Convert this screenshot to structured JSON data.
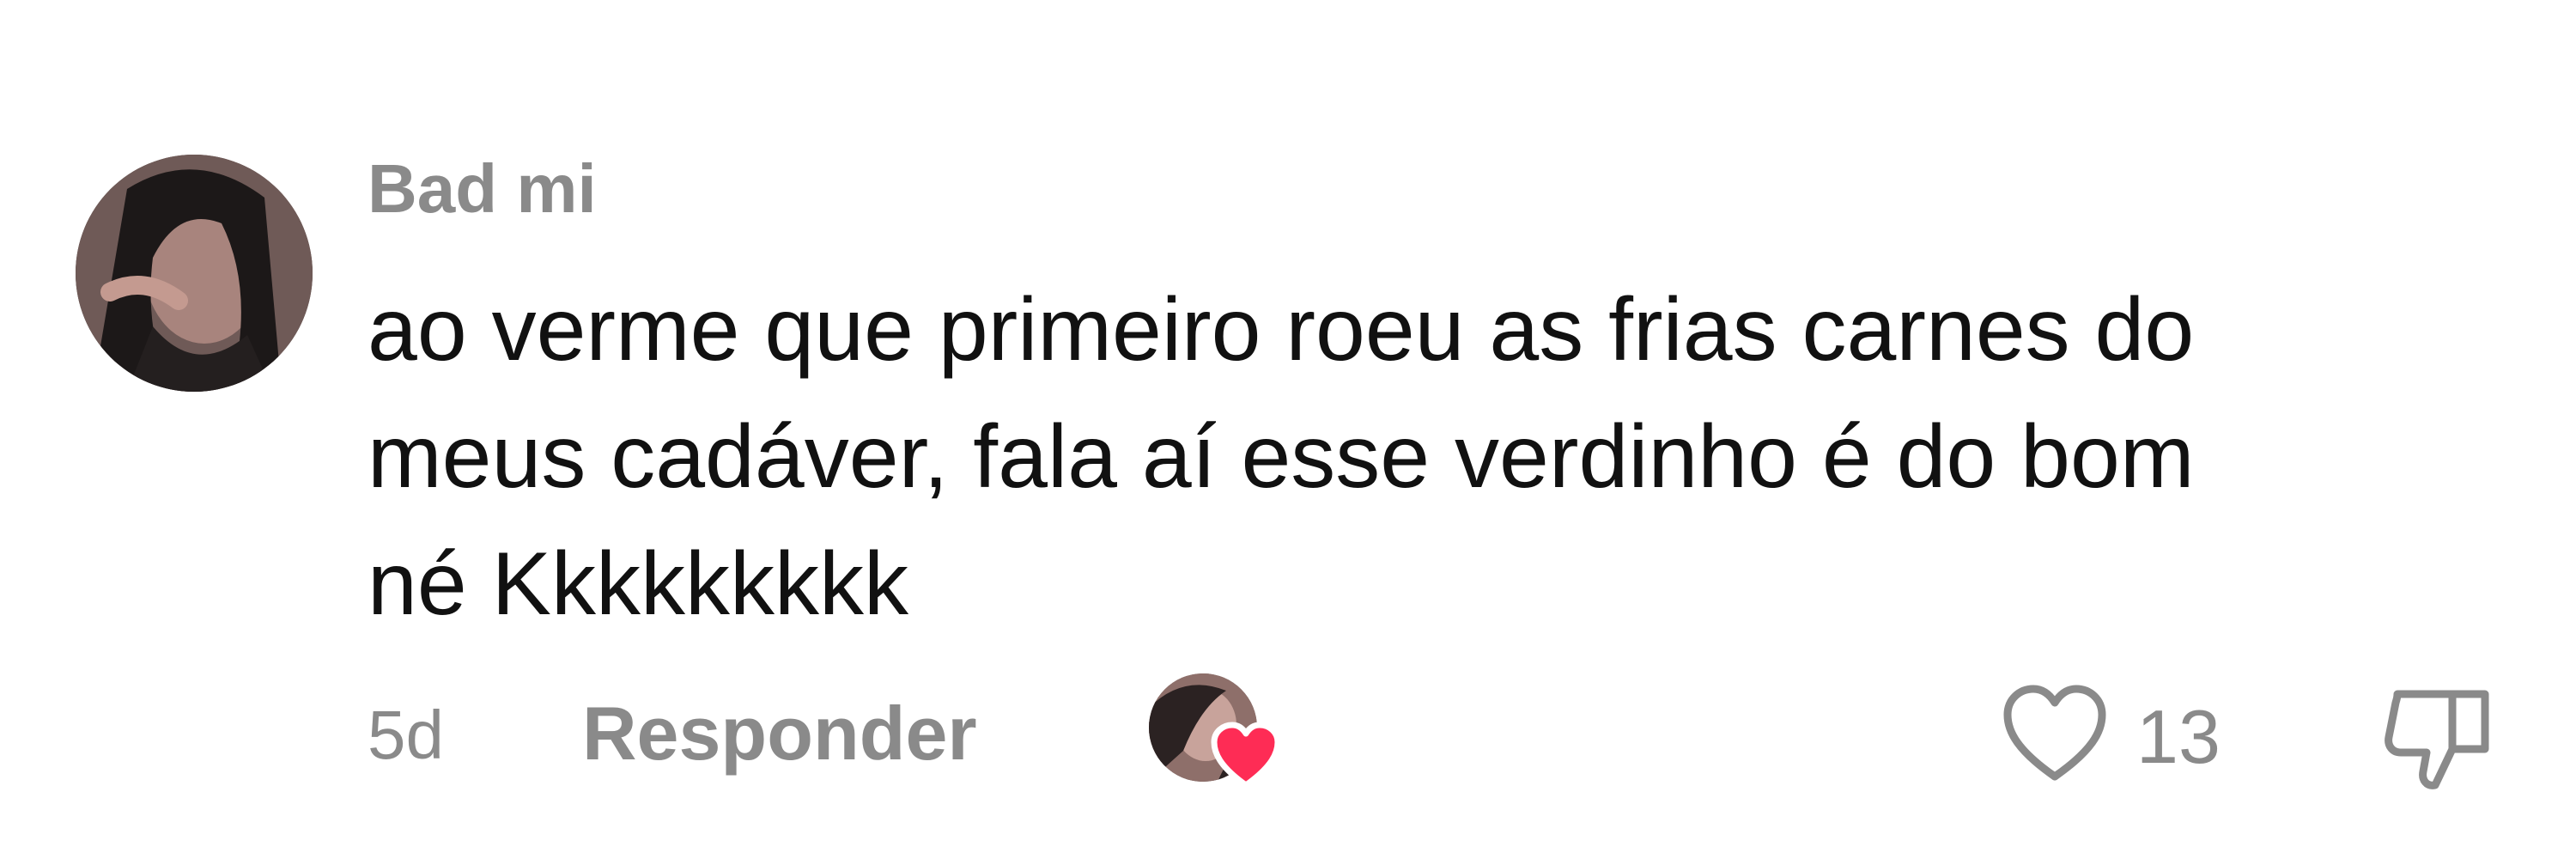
{
  "comment": {
    "username": "Bad mi",
    "text_lines": [
      "ao verme que primeiro roeu as frias carnes do",
      "meus cadáver, fala aí esse verdinho é do bom",
      "né Kkkkkkkkk"
    ],
    "timestamp": "5d",
    "reply_label": "Responder",
    "like_count": "13",
    "liked_by_creator": true,
    "colors": {
      "meta_text": "#8a8a8a",
      "body_text": "#111111",
      "heart_accent": "#fe2c55"
    },
    "icons": {
      "like": "heart-outline-icon",
      "dislike": "thumbs-down-icon",
      "creator_heart": "heart-filled-icon"
    }
  }
}
